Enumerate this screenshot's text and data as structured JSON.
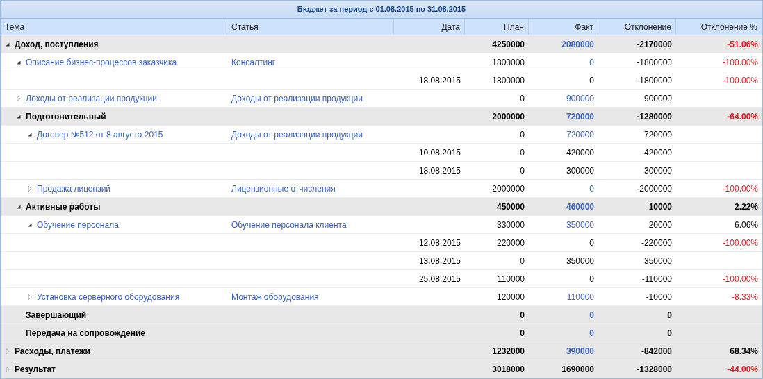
{
  "title": "Бюджет за период с 01.08.2015 по 31.08.2015",
  "columns": [
    {
      "label": "Тема"
    },
    {
      "label": "Статья"
    },
    {
      "label": "Дата"
    },
    {
      "label": "План"
    },
    {
      "label": "Факт"
    },
    {
      "label": "Отклонение"
    },
    {
      "label": "Отклонение %"
    }
  ],
  "rows": [
    {
      "kind": "group",
      "theme": "Доход, поступления",
      "expanded": true,
      "plan": "4250000",
      "fact": "2080000",
      "deviation": "-2170000",
      "percent": "-51.06%",
      "negative": true,
      "children": [
        {
          "kind": "item",
          "theme": "Описание бизнес-процессов заказчика",
          "article": "Консалтинг",
          "expanded": true,
          "plan": "1800000",
          "fact": "0",
          "deviation": "-1800000",
          "percent": "-100.00%",
          "negative": true,
          "children": [
            {
              "kind": "date",
              "date": "18.08.2015",
              "plan": "1800000",
              "fact": "0",
              "deviation": "-1800000",
              "percent": "-100.00%",
              "negative": true
            }
          ]
        },
        {
          "kind": "item",
          "theme": "Доходы от реализации продукции",
          "article": "Доходы от реализации продукции",
          "expanded": false,
          "plan": "0",
          "fact": "900000",
          "deviation": "900000"
        },
        {
          "kind": "group",
          "theme": "Подготовительный",
          "expanded": true,
          "plan": "2000000",
          "fact": "720000",
          "deviation": "-1280000",
          "percent": "-64.00%",
          "negative": true,
          "children": [
            {
              "kind": "item",
              "theme": "Договор №512 от 8 августа 2015",
              "article": "Доходы от реализации продукции",
              "expanded": true,
              "plan": "0",
              "fact": "720000",
              "deviation": "720000",
              "children": [
                {
                  "kind": "date",
                  "date": "10.08.2015",
                  "plan": "0",
                  "fact": "420000",
                  "deviation": "420000"
                },
                {
                  "kind": "date",
                  "date": "18.08.2015",
                  "plan": "0",
                  "fact": "300000",
                  "deviation": "300000"
                }
              ]
            },
            {
              "kind": "item",
              "theme": "Продажа лицензий",
              "article": "Лицензионные отчисления",
              "expanded": false,
              "plan": "2000000",
              "fact": "0",
              "deviation": "-2000000",
              "percent": "-100.00%",
              "negative": true
            }
          ]
        },
        {
          "kind": "group",
          "theme": "Активные работы",
          "expanded": true,
          "plan": "450000",
          "fact": "460000",
          "deviation": "10000",
          "percent": "2.22%",
          "negative": false,
          "children": [
            {
              "kind": "item",
              "theme": "Обучение персонала",
              "article": "Обучение персонала клиента",
              "expanded": true,
              "plan": "330000",
              "fact": "350000",
              "deviation": "20000",
              "percent": "6.06%",
              "negative": false,
              "children": [
                {
                  "kind": "date",
                  "date": "12.08.2015",
                  "plan": "220000",
                  "fact": "0",
                  "deviation": "-220000",
                  "percent": "-100.00%",
                  "negative": true
                },
                {
                  "kind": "date",
                  "date": "13.08.2015",
                  "plan": "0",
                  "fact": "350000",
                  "deviation": "350000"
                },
                {
                  "kind": "date",
                  "date": "25.08.2015",
                  "plan": "110000",
                  "fact": "0",
                  "deviation": "-110000",
                  "percent": "-100.00%",
                  "negative": true
                }
              ]
            },
            {
              "kind": "item",
              "theme": "Установка серверного оборудования",
              "article": "Монтаж оборудования",
              "expanded": false,
              "plan": "120000",
              "fact": "110000",
              "deviation": "-10000",
              "percent": "-8.33%",
              "negative": true
            }
          ]
        },
        {
          "kind": "group",
          "theme": "Завершающий",
          "plan": "0",
          "fact": "0",
          "deviation": "0"
        },
        {
          "kind": "group",
          "theme": "Передача на сопровождение",
          "plan": "0",
          "fact": "0",
          "deviation": "0"
        }
      ]
    },
    {
      "kind": "group",
      "theme": "Расходы, платежи",
      "expanded": false,
      "plan": "1232000",
      "fact": "390000",
      "deviation": "-842000",
      "percent": "68.34%",
      "negative": false
    },
    {
      "kind": "total",
      "theme": "Результат",
      "expanded": false,
      "plan": "3018000",
      "fact": "1690000",
      "deviation": "-1328000",
      "percent": "-44.00%",
      "negative": true
    }
  ]
}
